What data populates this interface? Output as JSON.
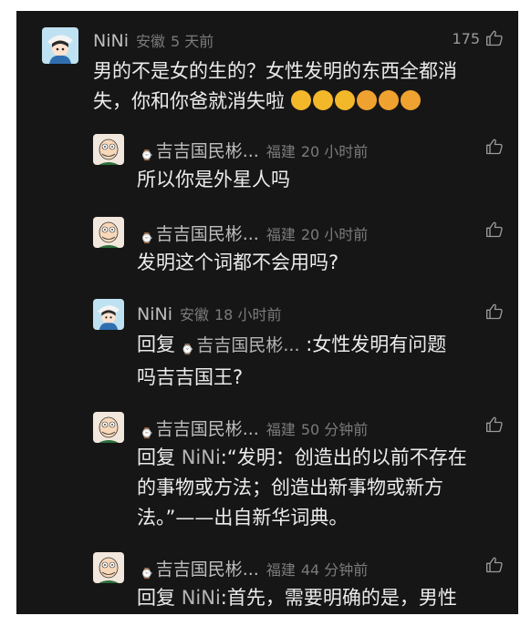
{
  "comments": [
    {
      "user": "NiNi",
      "location": "安徽",
      "time": "5 天前",
      "likes": "175",
      "text_lines": [
        "男的不是女的生的？女性发明的东西全都消",
        "失，你和你爸就消失啦"
      ],
      "emojis": [
        "grinning-face",
        "grinning-face",
        "grinning-face",
        "thinking-face",
        "thinking-face",
        "thinking-face"
      ],
      "avatar": "girl-avatar"
    },
    {
      "user": "吉吉国民彬...",
      "location": "福建",
      "time": "20 小时前",
      "text_lines": [
        "所以你是外星人吗"
      ],
      "avatar": "peter-avatar"
    },
    {
      "user": "吉吉国民彬...",
      "location": "福建",
      "time": "20 小时前",
      "text_lines": [
        "发明这个词都不会用吗?"
      ],
      "avatar": "peter-avatar"
    },
    {
      "user": "NiNi",
      "location": "安徽",
      "time": "18 小时前",
      "reply_prefix": "回复",
      "reply_to": "吉吉国民彬...",
      "text_after": ":女性发明有问题",
      "text_lines": [
        "吗吉吉国王?"
      ],
      "avatar": "girl-avatar"
    },
    {
      "user": "吉吉国民彬...",
      "location": "福建",
      "time": "50 分钟前",
      "reply_prefix": "回复",
      "reply_to": "NiNi",
      "text_after": ":“发明：创造出的以前不存在",
      "text_lines": [
        "的事物或方法；创造出新事物或新方",
        "法。”——出自新华词典。"
      ],
      "avatar": "peter-avatar"
    },
    {
      "user": "吉吉国民彬...",
      "location": "福建",
      "time": "44 分钟前",
      "reply_prefix": "回复",
      "reply_to": "NiNi",
      "text_after": ":首先，需要明确的是，男性",
      "avatar": "peter-avatar"
    }
  ],
  "colors": {
    "background": "#161616",
    "text": "#ececec",
    "meta": "#7b7b7b",
    "name": "#bdbdbd"
  }
}
